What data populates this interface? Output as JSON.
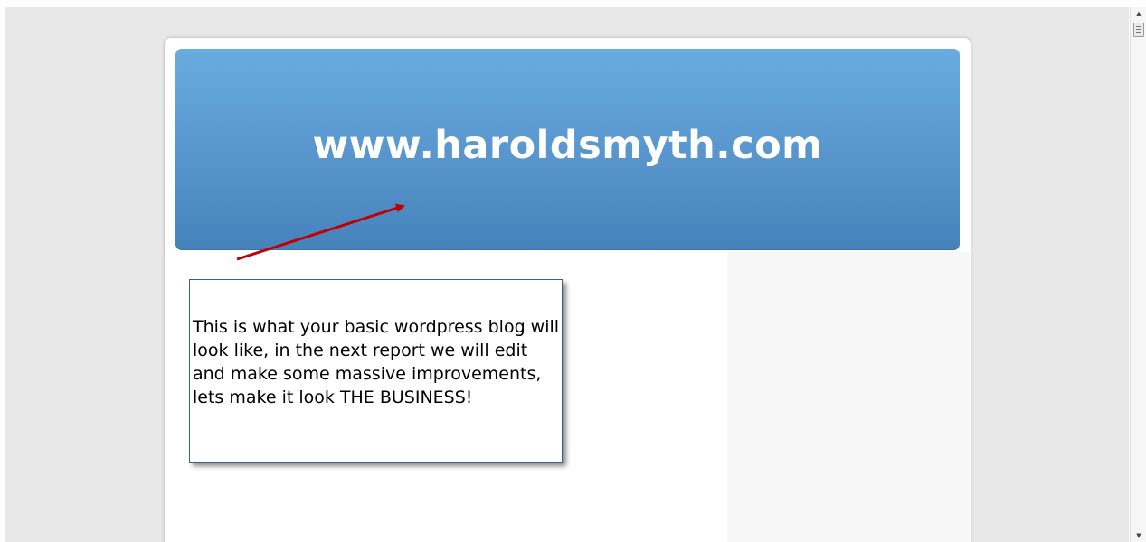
{
  "site": {
    "title": "www.haroldsmyth.com"
  },
  "annotation": {
    "text": "This is what your basic wordpress blog will look like, in the next report we will edit and make some massive improvements, lets make it look THE BUSINESS!",
    "arrow_color": "#c00000"
  },
  "colors": {
    "header_top": "#69acdf",
    "header_bottom": "#4682bb",
    "page_background": "#e8e8e8",
    "sidebar_background": "#f7f7f7"
  },
  "icons": {
    "scroll_up": "triangle-up",
    "scroll_down": "triangle-down",
    "scroll_thumb_grip": "three-line-grip"
  }
}
